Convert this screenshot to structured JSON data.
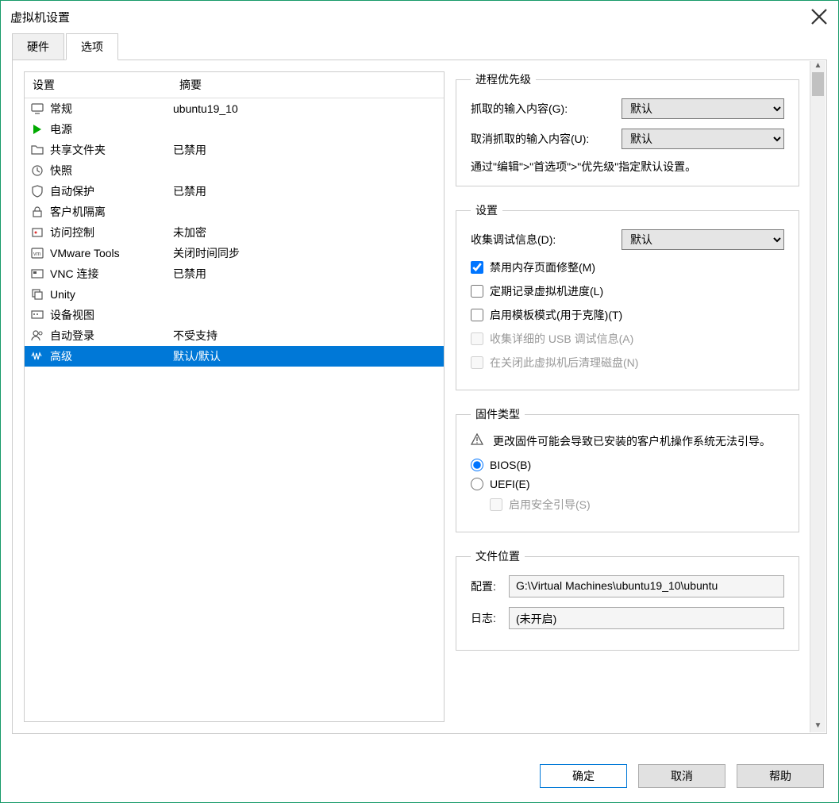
{
  "window": {
    "title": "虚拟机设置"
  },
  "tabs": {
    "hardware": "硬件",
    "options": "选项"
  },
  "list": {
    "header_setting": "设置",
    "header_summary": "摘要",
    "items": [
      {
        "name": "常规",
        "summary": "ubuntu19_10",
        "icon": "monitor"
      },
      {
        "name": "电源",
        "summary": "",
        "icon": "play"
      },
      {
        "name": "共享文件夹",
        "summary": "已禁用",
        "icon": "folder"
      },
      {
        "name": "快照",
        "summary": "",
        "icon": "clock"
      },
      {
        "name": "自动保护",
        "summary": "已禁用",
        "icon": "shield-clock"
      },
      {
        "name": "客户机隔离",
        "summary": "",
        "icon": "lock"
      },
      {
        "name": "访问控制",
        "summary": "未加密",
        "icon": "key"
      },
      {
        "name": "VMware Tools",
        "summary": "关闭时间同步",
        "icon": "vm"
      },
      {
        "name": "VNC 连接",
        "summary": "已禁用",
        "icon": "vnc"
      },
      {
        "name": "Unity",
        "summary": "",
        "icon": "window"
      },
      {
        "name": "设备视图",
        "summary": "",
        "icon": "device"
      },
      {
        "name": "自动登录",
        "summary": "不受支持",
        "icon": "user"
      },
      {
        "name": "高级",
        "summary": "默认/默认",
        "icon": "wave"
      }
    ],
    "selected_index": 12
  },
  "priority": {
    "legend": "进程优先级",
    "grabbed_label": "抓取的输入内容(G):",
    "grabbed_value": "默认",
    "ungrabbed_label": "取消抓取的输入内容(U):",
    "ungrabbed_value": "默认",
    "helptext": "通过\"编辑\">\"首选项\">\"优先级\"指定默认设置。"
  },
  "settings": {
    "legend": "设置",
    "debug_label": "收集调试信息(D):",
    "debug_value": "默认",
    "cb_mem": "禁用内存页面修整(M)",
    "cb_log": "定期记录虚拟机进度(L)",
    "cb_template": "启用模板模式(用于克隆)(T)",
    "cb_usb": "收集详细的 USB 调试信息(A)",
    "cb_clean": "在关闭此虚拟机后清理磁盘(N)"
  },
  "firmware": {
    "legend": "固件类型",
    "warning": "更改固件可能会导致已安装的客户机操作系统无法引导。",
    "bios": "BIOS(B)",
    "uefi": "UEFI(E)",
    "secure_boot": "启用安全引导(S)"
  },
  "file_location": {
    "legend": "文件位置",
    "config_label": "配置:",
    "config_value": "G:\\Virtual Machines\\ubuntu19_10\\ubuntu",
    "log_label": "日志:",
    "log_value": "(未开启)"
  },
  "buttons": {
    "ok": "确定",
    "cancel": "取消",
    "help": "帮助"
  }
}
